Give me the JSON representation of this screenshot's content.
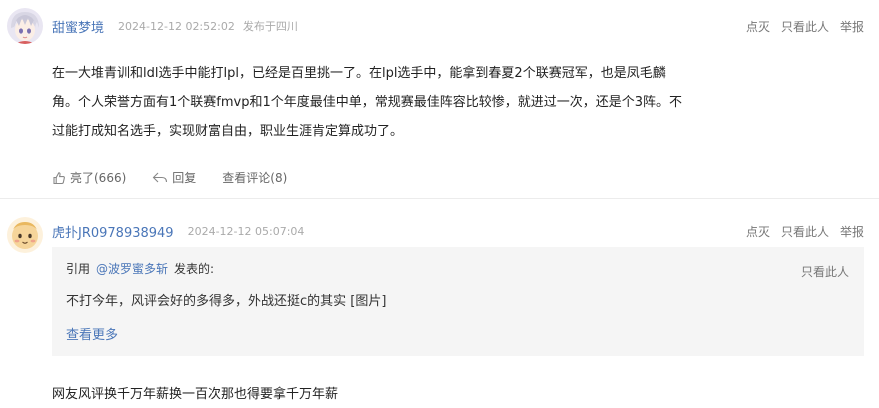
{
  "posts": [
    {
      "username": "甜蜜梦境",
      "timestamp": "2024-12-12 02:52:02",
      "location": "发布于四川",
      "ops": [
        "点灭",
        "只看此人",
        "举报"
      ],
      "content_lines": [
        "在一大堆青训和ldl选手中能打lpl，已经是百里挑一了。在lpl选手中，能拿到春夏2个联赛冠军，也是凤毛麟",
        "角。个人荣誉方面有1个联赛fmvp和1个年度最佳中单，常规赛最佳阵容比较惨，就进过一次，还是个3阵。不",
        "过能打成知名选手，实现财富自由，职业生涯肯定算成功了。"
      ],
      "actions": {
        "like": "亮了(666)",
        "reply": "回复",
        "view_comments": "查看评论(8)"
      }
    },
    {
      "username": "虎扑JR0978938949",
      "timestamp": "2024-12-12 05:07:04",
      "ops": [
        "点灭",
        "只看此人",
        "举报"
      ],
      "quote": {
        "prefix": "引用",
        "ref_user": "@波罗蜜多斩",
        "suffix": "发表的:",
        "only_this": "只看此人",
        "text": "不打今年，风评会好的多得多，外战还挺c的其实 [图片]",
        "more": "查看更多"
      },
      "reply": "网友风评换千万年薪换一百次那也得要拿千万年薪"
    }
  ],
  "colors": {
    "link": "#4a76b8",
    "meta": "#aaaaaa",
    "quote_bg": "#f5f5f5"
  },
  "icons": [
    "thumb-up-icon",
    "reply-arrow-icon"
  ]
}
